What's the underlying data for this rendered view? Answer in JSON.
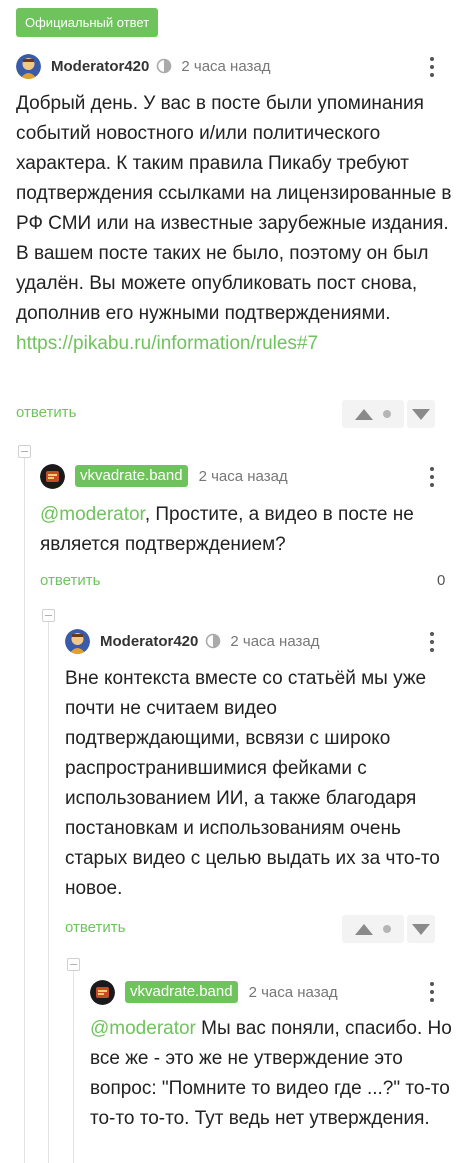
{
  "badge": "Официальный ответ",
  "comments": [
    {
      "author": "Moderator420",
      "time": "2 часа назад",
      "text": "Добрый день. У вас в посте были упоминания событий новостного и/или политического характера. К таким правила Пикабу требуют подтверждения ссылками на лицензированные в РФ СМИ или на известные зарубежные издания. В вашем посте таких не было, поэтому он был удалён. Вы можете опубликовать пост снова, дополнив его нужными подтверждениями.",
      "link": "https://pikabu.ru/information/rules#7",
      "reply": "ответить"
    },
    {
      "author": "vkvadrate.band",
      "time": "2 часа назад",
      "mention": "@moderator",
      "text": ", Простите, а видео в посте не является подтверждением?",
      "reply": "ответить",
      "score": "0"
    },
    {
      "author": "Moderator420",
      "time": "2 часа назад",
      "text": "Вне контекста вместе со статьёй мы уже почти не считаем видео подтверждающими, всвязи с широко распространившимися фейками с использованием ИИ, а также благодаря постановкам и использованиям очень старых видео с целью выдать их за что-то новое.",
      "reply": "ответить"
    },
    {
      "author": "vkvadrate.band",
      "time": "2 часа назад",
      "mention": "@moderator",
      "text": " Мы вас поняли, спасибо. Но все же - это же не утверждение это вопрос: \"Помните то видео где ...?\" то-то то-то то-то. Тут ведь нет утверждения."
    }
  ],
  "colors": {
    "accent": "#6fc35c",
    "vote_bg": "#f3f3f3",
    "muted": "#777777"
  },
  "icons": [
    "moderator-avatar",
    "band-avatar",
    "moderator-badge-icon",
    "more-icon",
    "upvote-icon",
    "downvote-icon",
    "collapse-icon"
  ]
}
